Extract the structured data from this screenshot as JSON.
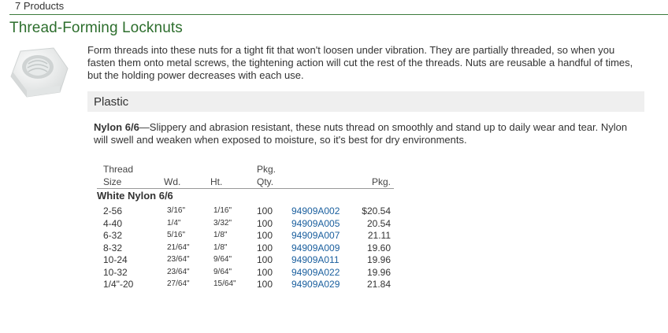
{
  "header": {
    "product_count": "7 Products"
  },
  "product": {
    "title": "Thread-Forming Locknuts",
    "description": "Form threads into these nuts for a tight fit that won't loosen under vibration. They are partially threaded, so when you fasten them onto metal screws, the tightening action will cut the rest of the threads. Nuts are reusable a handful of times, but the holding power decreases with each use.",
    "image_icon": "hex-nut-icon"
  },
  "section": {
    "title": "Plastic",
    "material_name": "Nylon 6/6",
    "material_text": "—Slippery and abrasion resistant, these nuts thread on smoothly and stand up to daily wear and tear. Nylon will swell and weaken when exposed to moisture, so it's best for dry environments."
  },
  "table": {
    "headers": {
      "thread_line1": "Thread",
      "thread_line2": "Size",
      "wd": "Wd.",
      "ht": "Ht.",
      "qty_line1": "Pkg.",
      "qty_line2": "Qty.",
      "price": "Pkg."
    },
    "group": "White Nylon 6/6",
    "rows": [
      {
        "thread": "2-56",
        "wd": "3/16\"",
        "ht": "1/16\"",
        "qty": "100",
        "part": "94909A002",
        "price": "$20.54"
      },
      {
        "thread": "4-40",
        "wd": "1/4\"",
        "ht": "3/32\"",
        "qty": "100",
        "part": "94909A005",
        "price": "20.54"
      },
      {
        "thread": "6-32",
        "wd": "5/16\"",
        "ht": "1/8\"",
        "qty": "100",
        "part": "94909A007",
        "price": "21.11"
      },
      {
        "thread": "8-32",
        "wd": "21/64\"",
        "ht": "1/8\"",
        "qty": "100",
        "part": "94909A009",
        "price": "19.60"
      },
      {
        "thread": "10-24",
        "wd": "23/64\"",
        "ht": "9/64\"",
        "qty": "100",
        "part": "94909A011",
        "price": "19.96"
      },
      {
        "thread": "10-32",
        "wd": "23/64\"",
        "ht": "9/64\"",
        "qty": "100",
        "part": "94909A022",
        "price": "19.96"
      },
      {
        "thread": "1/4\"-20",
        "wd": "27/64\"",
        "ht": "15/64\"",
        "qty": "100",
        "part": "94909A029",
        "price": "21.84"
      }
    ]
  }
}
